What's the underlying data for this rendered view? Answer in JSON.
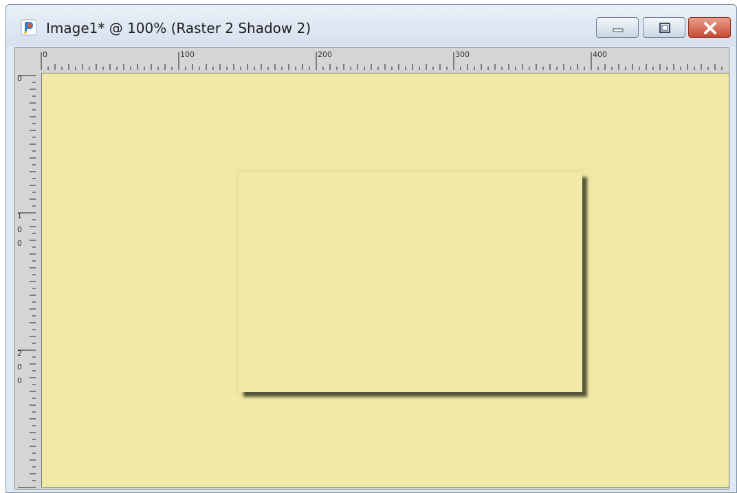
{
  "window": {
    "title": "Image1* @ 100% (Raster 2 Shadow 2)",
    "minimize_icon": "minimize-icon",
    "maximize_icon": "maximize-icon",
    "close_icon": "close-icon",
    "close_color": "#c64a33"
  },
  "rulers": {
    "horizontal_labels": [
      "0",
      "100",
      "200",
      "300",
      "400"
    ],
    "vertical_labels": [
      [
        "0"
      ],
      [
        "1",
        "0",
        "0"
      ],
      [
        "2",
        "0",
        "0"
      ]
    ]
  },
  "canvas": {
    "background_color": "#f0eaa6",
    "shape": "rectangle with drop shadow"
  }
}
